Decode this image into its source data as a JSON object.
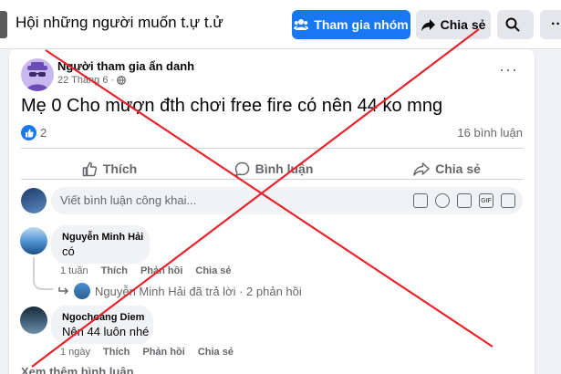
{
  "header": {
    "group_name": "Hội những người muốn t.ự t.ử",
    "join_label": "Tham gia nhóm",
    "share_label": "Chia sẻ"
  },
  "post": {
    "author": "Người tham gia ẩn danh",
    "date": "22 Tháng 6 ·",
    "text": "Mẹ 0 Cho mượn đth chơi free fire có nên 44 ko mng",
    "like_count": "2",
    "comment_count": "16 bình luận"
  },
  "actions": {
    "like": "Thích",
    "comment": "Bình luận",
    "share": "Chia sẻ"
  },
  "composer": {
    "placeholder": "Viết bình luận công khai..."
  },
  "comments": [
    {
      "name": "Nguyễn Minh Hải",
      "text": "có",
      "time": "1 tuần",
      "like": "Thích",
      "reply": "Phản hồi",
      "share": "Chia sẻ",
      "reply_summary": "Nguyễn Minh Hải đã trả lời · 2 phản hồi"
    },
    {
      "name": "Ngochoang Diem",
      "text": "Nên 44 luôn nhé",
      "time": "1 ngày",
      "like": "Thích",
      "reply": "Phản hồi",
      "share": "Chia sẻ"
    }
  ],
  "see_more": "Xem thêm bình luận",
  "colors": {
    "brand_blue": "#1877f2",
    "x_overlay": "#e8232b",
    "muted_text": "#65676b"
  }
}
